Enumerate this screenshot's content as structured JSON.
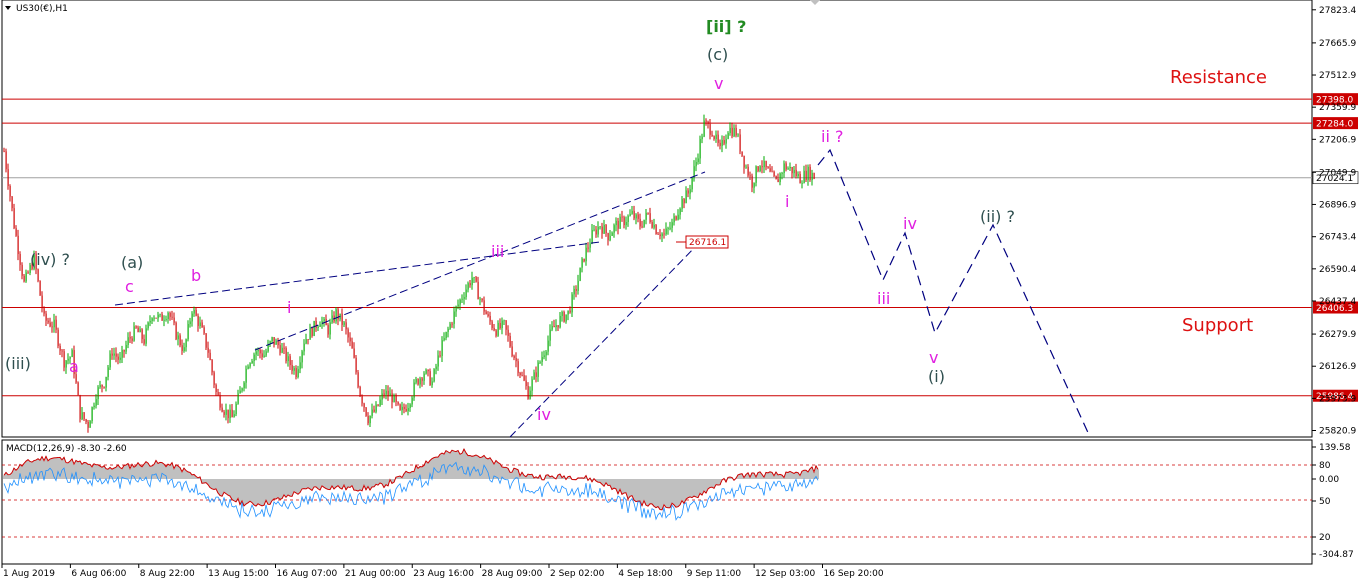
{
  "window": {
    "symbol_title": "US30(€),H1"
  },
  "colors": {
    "background": "#ffffff",
    "level_line": "#cc0000",
    "projection": "#000080",
    "trendline": "#000080",
    "wave_magenta": "#e020e0",
    "wave_dark": "#2f4f4f",
    "wave_green": "#228B22",
    "candle_up": "#00aa00",
    "candle_down": "#cc0000",
    "macd_hist": "#c0c0c0",
    "macd_signal": "#cc0000",
    "macd_line": "#1e90ff"
  },
  "chart_data": [
    {
      "type": "candlestick",
      "title": "US30(€),H1",
      "xlabel": "",
      "ylabel": "",
      "ylim": [
        25790,
        27870
      ],
      "price_axis_ticks": [
        "27823.4",
        "27665.9",
        "27512.9",
        "27359.9",
        "27206.9",
        "27049.9",
        "26896.9",
        "26743.4",
        "26590.4",
        "26437.4",
        "26279.9",
        "26126.9",
        "25973.9",
        "25820.9"
      ],
      "date_ticks": [
        "1 Aug 2019",
        "6 Aug 06:00",
        "8 Aug 22:00",
        "13 Aug 15:00",
        "16 Aug 07:00",
        "21 Aug 00:00",
        "23 Aug 16:00",
        "28 Aug 09:00",
        "2 Sep 02:00",
        "4 Sep 18:00",
        "9 Sep 11:00",
        "12 Sep 03:00",
        "16 Sep 20:00"
      ],
      "horizontal_levels": [
        {
          "value": 27398.0,
          "label": "27398.0"
        },
        {
          "value": 27284.0,
          "label": "27284.0"
        },
        {
          "value": 26406.3,
          "label": "26406.3"
        },
        {
          "value": 25986.4,
          "label": "25986.4"
        }
      ],
      "current_price": {
        "value": 27024.1,
        "label": "27024.1"
      },
      "marked_price": {
        "value": 26716.1,
        "label": "26716.1"
      },
      "zone_labels": {
        "resistance": "Resistance",
        "support": "Support"
      },
      "price_path": [
        [
          0,
          27150
        ],
        [
          5,
          26800
        ],
        [
          10,
          26520
        ],
        [
          15,
          26640
        ],
        [
          20,
          26350
        ],
        [
          25,
          26320
        ],
        [
          30,
          26150
        ],
        [
          34,
          26180
        ],
        [
          38,
          25900
        ],
        [
          42,
          25850
        ],
        [
          46,
          26000
        ],
        [
          50,
          26050
        ],
        [
          54,
          26200
        ],
        [
          58,
          26150
        ],
        [
          62,
          26250
        ],
        [
          66,
          26300
        ],
        [
          70,
          26250
        ],
        [
          74,
          26380
        ],
        [
          78,
          26350
        ],
        [
          82,
          26390
        ],
        [
          86,
          26280
        ],
        [
          90,
          26200
        ],
        [
          94,
          26400
        ],
        [
          98,
          26320
        ],
        [
          102,
          26200
        ],
        [
          106,
          26000
        ],
        [
          110,
          25920
        ],
        [
          114,
          25880
        ],
        [
          118,
          26000
        ],
        [
          122,
          26150
        ],
        [
          126,
          26200
        ],
        [
          130,
          26180
        ],
        [
          134,
          26250
        ],
        [
          138,
          26220
        ],
        [
          142,
          26150
        ],
        [
          146,
          26100
        ],
        [
          150,
          26250
        ],
        [
          154,
          26300
        ],
        [
          158,
          26350
        ],
        [
          162,
          26300
        ],
        [
          166,
          26380
        ],
        [
          170,
          26320
        ],
        [
          174,
          26200
        ],
        [
          178,
          26000
        ],
        [
          182,
          25880
        ],
        [
          186,
          25920
        ],
        [
          190,
          26000
        ],
        [
          194,
          25980
        ],
        [
          198,
          25900
        ],
        [
          202,
          25950
        ],
        [
          206,
          26050
        ],
        [
          210,
          26100
        ],
        [
          214,
          26050
        ],
        [
          218,
          26200
        ],
        [
          222,
          26300
        ],
        [
          226,
          26400
        ],
        [
          230,
          26480
        ],
        [
          234,
          26550
        ],
        [
          238,
          26450
        ],
        [
          242,
          26350
        ],
        [
          246,
          26300
        ],
        [
          250,
          26320
        ],
        [
          254,
          26200
        ],
        [
          258,
          26100
        ],
        [
          262,
          26000
        ],
        [
          266,
          26100
        ],
        [
          270,
          26200
        ],
        [
          274,
          26300
        ],
        [
          278,
          26350
        ],
        [
          282,
          26380
        ],
        [
          286,
          26500
        ],
        [
          290,
          26650
        ],
        [
          294,
          26750
        ],
        [
          298,
          26800
        ],
        [
          302,
          26750
        ],
        [
          306,
          26800
        ],
        [
          310,
          26820
        ],
        [
          314,
          26850
        ],
        [
          318,
          26800
        ],
        [
          322,
          26850
        ],
        [
          326,
          26780
        ],
        [
          330,
          26750
        ],
        [
          334,
          26800
        ],
        [
          338,
          26900
        ],
        [
          342,
          26950
        ],
        [
          346,
          27100
        ],
        [
          350,
          27280
        ],
        [
          354,
          27250
        ],
        [
          358,
          27150
        ],
        [
          362,
          27260
        ],
        [
          366,
          27240
        ],
        [
          370,
          27100
        ],
        [
          374,
          27000
        ],
        [
          378,
          27100
        ],
        [
          382,
          27050
        ],
        [
          386,
          27000
        ],
        [
          390,
          27080
        ],
        [
          394,
          27060
        ],
        [
          398,
          27020
        ],
        [
          402,
          27050
        ],
        [
          406,
          27024
        ]
      ],
      "wave_labels": [
        {
          "text": "[ii] ?",
          "color": "green"
        },
        {
          "text": "(c)",
          "color": "dark"
        },
        {
          "text": "v",
          "color": "magenta"
        },
        {
          "text": "ii ?",
          "color": "magenta"
        },
        {
          "text": "i",
          "color": "magenta"
        },
        {
          "text": "iii",
          "color": "magenta"
        },
        {
          "text": "iv",
          "color": "magenta"
        },
        {
          "text": "iv",
          "color": "magenta"
        },
        {
          "text": "(ii) ?",
          "color": "dark"
        },
        {
          "text": "iii",
          "color": "magenta"
        },
        {
          "text": "v",
          "color": "magenta"
        },
        {
          "text": "(i)",
          "color": "dark"
        },
        {
          "text": "i",
          "color": "magenta"
        },
        {
          "text": "(iv) ?",
          "color": "dark"
        },
        {
          "text": "(a)",
          "color": "dark"
        },
        {
          "text": "c",
          "color": "magenta"
        },
        {
          "text": "b",
          "color": "magenta"
        },
        {
          "text": "(iii)",
          "color": "dark"
        },
        {
          "text": "a",
          "color": "magenta"
        }
      ],
      "projection_path": [
        [
          27090,
          0
        ],
        [
          27150,
          1
        ],
        [
          26620,
          2
        ],
        [
          26780,
          3
        ],
        [
          26340,
          4
        ],
        [
          26810,
          5
        ],
        [
          25800,
          6
        ]
      ]
    },
    {
      "type": "macd",
      "title": "MACD(12,26,9) -8.30 -2.60",
      "params": "12,26,9",
      "value_main": -8.3,
      "value_signal": -2.6,
      "axis_ticks": [
        "139.58",
        "80",
        "0.00",
        "50",
        "20",
        "-304.87"
      ],
      "dashed_levels": [
        80,
        0,
        -50
      ],
      "ylim": [
        -304.87,
        139.58
      ]
    }
  ]
}
